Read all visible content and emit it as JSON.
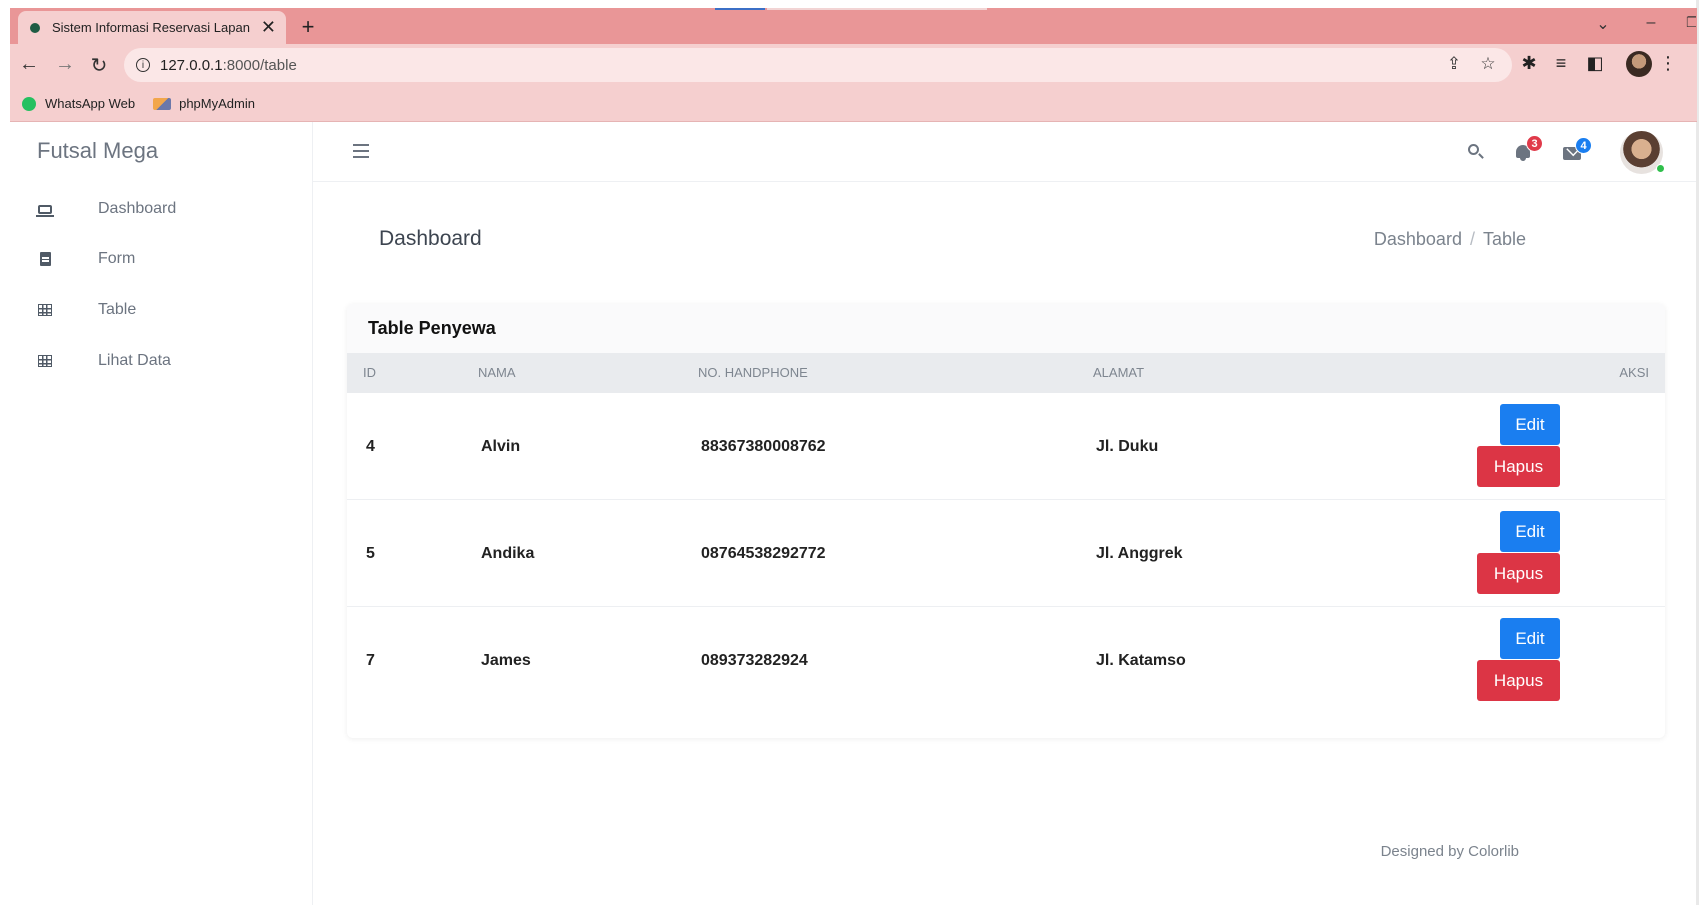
{
  "browser": {
    "tab_title": "Sistem Informasi Reservasi Lapan",
    "url_host": "127.0.0.1",
    "url_path": ":8000/table",
    "bookmarks": [
      {
        "label": "WhatsApp Web"
      },
      {
        "label": "phpMyAdmin"
      }
    ]
  },
  "app": {
    "brand": "Futsal Mega",
    "nav": [
      {
        "label": "Dashboard",
        "icon": "laptop-icon"
      },
      {
        "label": "Form",
        "icon": "file-icon"
      },
      {
        "label": "Table",
        "icon": "table-icon"
      },
      {
        "label": "Lihat Data",
        "icon": "table-icon"
      }
    ],
    "notifications_count": "3",
    "messages_count": "4"
  },
  "page": {
    "title": "Dashboard",
    "breadcrumb": [
      "Dashboard",
      "Table"
    ]
  },
  "table": {
    "title": "Table Penyewa",
    "columns": [
      "ID",
      "NAMA",
      "NO. HANDPHONE",
      "ALAMAT",
      "AKSI"
    ],
    "rows": [
      {
        "id": "4",
        "nama": "Alvin",
        "hp": "88367380008762",
        "alamat": "Jl. Duku"
      },
      {
        "id": "5",
        "nama": "Andika",
        "hp": "08764538292772",
        "alamat": "Jl. Anggrek"
      },
      {
        "id": "7",
        "nama": "James",
        "hp": "089373282924",
        "alamat": "Jl. Katamso"
      }
    ],
    "edit_label": "Edit",
    "delete_label": "Hapus"
  },
  "footer": "Designed by Colorlib",
  "colors": {
    "edit": "#1a7ef0",
    "delete": "#dc3545",
    "chrome": "#e99697"
  }
}
